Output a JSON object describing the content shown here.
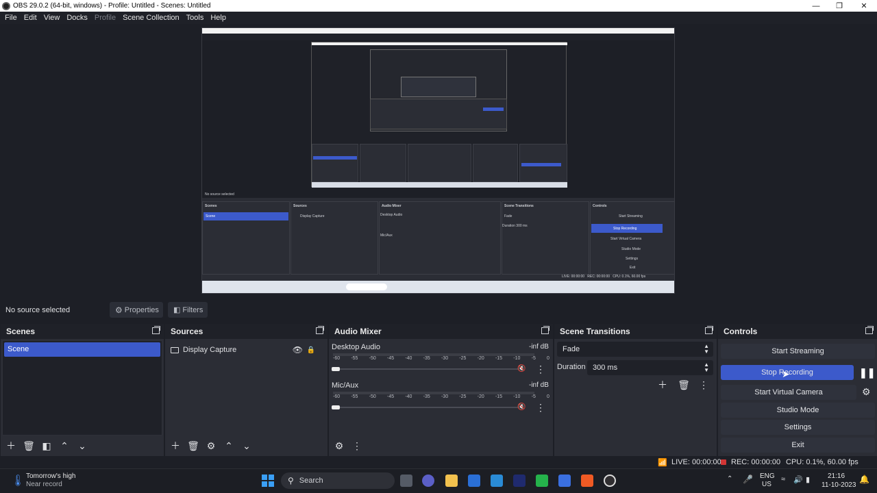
{
  "window": {
    "title": "OBS 29.0.2 (64-bit, windows) - Profile: Untitled - Scenes: Untitled",
    "minimize_icon": "minimize-icon",
    "maximize_icon": "maximize-icon",
    "close_icon": "close-icon"
  },
  "menu": {
    "items": [
      "File",
      "Edit",
      "View",
      "Docks",
      "Profile",
      "Scene Collection",
      "Tools",
      "Help"
    ]
  },
  "source_toolbar": {
    "status": "No source selected",
    "properties": "Properties",
    "filters": "Filters"
  },
  "scenes": {
    "title": "Scenes",
    "items": [
      "Scene"
    ]
  },
  "sources": {
    "title": "Sources",
    "items": [
      {
        "name": "Display Capture"
      }
    ]
  },
  "audio_mixer": {
    "title": "Audio Mixer",
    "channels": [
      {
        "name": "Desktop Audio",
        "level": "-inf dB"
      },
      {
        "name": "Mic/Aux",
        "level": "-inf dB"
      }
    ],
    "scale": [
      "-60",
      "-55",
      "-50",
      "-45",
      "-40",
      "-35",
      "-30",
      "-25",
      "-20",
      "-15",
      "-10",
      "-5",
      "0"
    ]
  },
  "scene_transitions": {
    "title": "Scene Transitions",
    "transition": "Fade",
    "duration_label": "Duration",
    "duration_value": "300 ms"
  },
  "controls": {
    "title": "Controls",
    "start_streaming": "Start Streaming",
    "stop_recording": "Stop Recording",
    "start_virtual_camera": "Start Virtual Camera",
    "studio_mode": "Studio Mode",
    "settings": "Settings",
    "exit": "Exit"
  },
  "status": {
    "live": "LIVE: 00:00:00",
    "rec": "REC: 00:00:00",
    "cpu": "CPU: 0.1%, 60.00 fps"
  },
  "taskbar": {
    "weather_line1": "Tomorrow's high",
    "weather_line2": "Near record",
    "search": "Search",
    "lang1": "ENG",
    "lang2": "US",
    "time": "21:16",
    "date": "11-10-2023"
  },
  "colors": {
    "accent": "#3c5acb",
    "dock_bg": "#2b2d35",
    "window_bg": "#1d1f26"
  }
}
